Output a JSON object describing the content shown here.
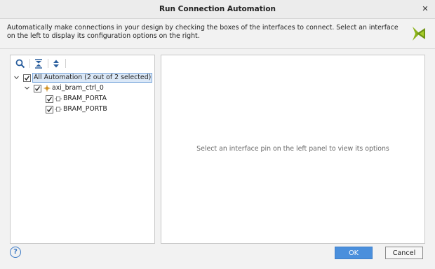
{
  "dialog": {
    "title": "Run Connection Automation",
    "description": "Automatically make connections in your design by checking the boxes of the interfaces to connect. Select an interface on the left to display its configuration options on the right."
  },
  "toolbar": {
    "icons": [
      "search-icon",
      "collapse-all-icon",
      "expand-all-icon"
    ]
  },
  "tree": {
    "root": {
      "label": "All Automation (2 out of 2 selected)",
      "checked": true,
      "expanded": true,
      "selected": true
    },
    "instance": {
      "label": "axi_bram_ctrl_0",
      "checked": true,
      "expanded": true
    },
    "interfaces": [
      {
        "label": "BRAM_PORTA",
        "checked": true
      },
      {
        "label": "BRAM_PORTB",
        "checked": true
      }
    ]
  },
  "right_panel": {
    "message": "Select an interface pin on the left panel to view its options"
  },
  "footer": {
    "help_label": "?",
    "ok_label": "OK",
    "cancel_label": "Cancel"
  },
  "colors": {
    "accent": "#4a8fdc",
    "selection_bg": "#dbe8f7",
    "logo": "#8bb21a"
  }
}
